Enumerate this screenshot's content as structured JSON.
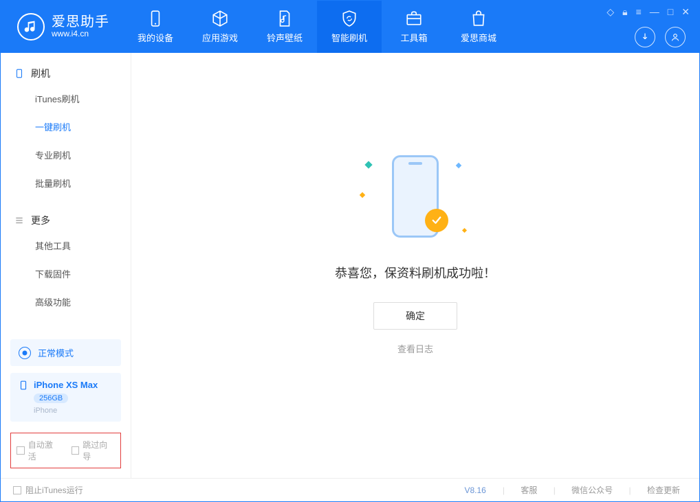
{
  "logo": {
    "cn": "爱思助手",
    "en": "www.i4.cn"
  },
  "tabs": [
    {
      "label": "我的设备"
    },
    {
      "label": "应用游戏"
    },
    {
      "label": "铃声壁纸"
    },
    {
      "label": "智能刷机"
    },
    {
      "label": "工具箱"
    },
    {
      "label": "爱思商城"
    }
  ],
  "sidebar": {
    "section1": {
      "title": "刷机",
      "items": [
        "iTunes刷机",
        "一键刷机",
        "专业刷机",
        "批量刷机"
      ]
    },
    "section2": {
      "title": "更多",
      "items": [
        "其他工具",
        "下载固件",
        "高级功能"
      ]
    }
  },
  "mode_label": "正常模式",
  "device": {
    "name": "iPhone XS Max",
    "capacity": "256GB",
    "type": "iPhone"
  },
  "checks": {
    "auto_activate": "自动激活",
    "skip_guide": "跳过向导"
  },
  "main": {
    "success_text": "恭喜您，保资料刷机成功啦！",
    "ok_button": "确定",
    "view_log": "查看日志"
  },
  "footer": {
    "block_itunes": "阻止iTunes运行",
    "version": "V8.16",
    "links": [
      "客服",
      "微信公众号",
      "检查更新"
    ]
  }
}
